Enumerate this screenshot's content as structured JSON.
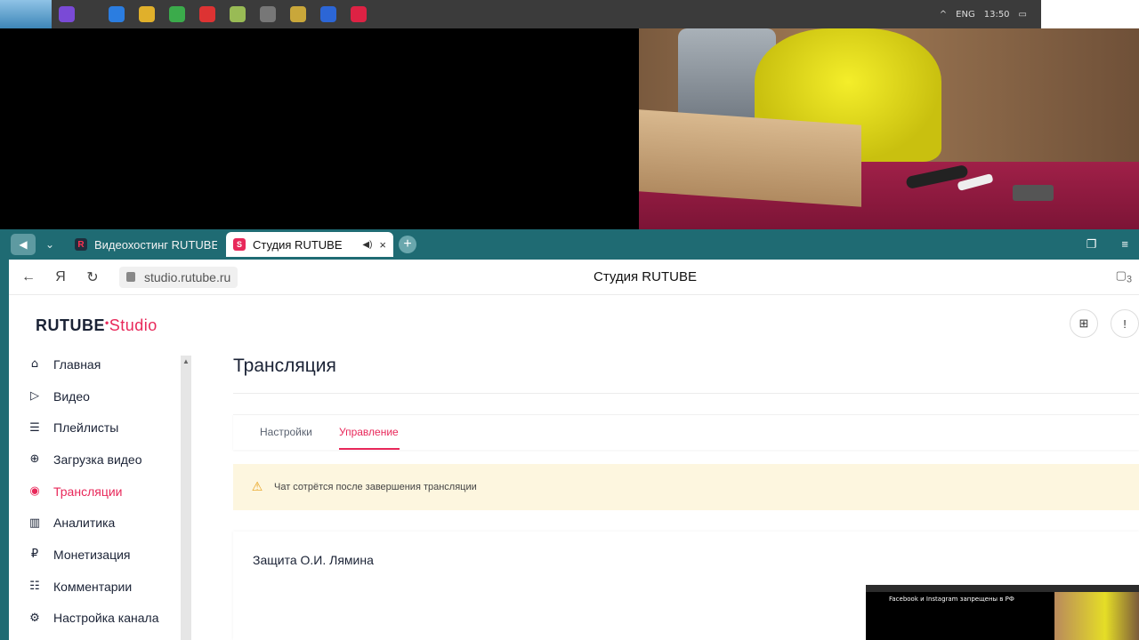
{
  "remote_taskbar": {
    "tray_lang": "ENG",
    "tray_time": "13:50"
  },
  "browser": {
    "tabs": [
      {
        "title": "Видеохостинг RUTUBE. С",
        "active": false
      },
      {
        "title": "Студия RUTUBE",
        "active": true
      }
    ],
    "url": "studio.rutube.ru",
    "page_title": "Студия RUTUBE",
    "counter": "3"
  },
  "logo": {
    "brand": "RUTUBE",
    "product": "Studio"
  },
  "sidebar": {
    "items": [
      {
        "label": "Главная",
        "icon": "home-icon",
        "glyph": "⌂"
      },
      {
        "label": "Видео",
        "icon": "video-icon",
        "glyph": "▷"
      },
      {
        "label": "Плейлисты",
        "icon": "playlist-icon",
        "glyph": "☰"
      },
      {
        "label": "Загрузка видео",
        "icon": "upload-icon",
        "glyph": "⊕"
      },
      {
        "label": "Трансляции",
        "icon": "broadcast-icon",
        "glyph": "◉"
      },
      {
        "label": "Аналитика",
        "icon": "analytics-icon",
        "glyph": "▥"
      },
      {
        "label": "Монетизация",
        "icon": "ruble-icon",
        "glyph": "₽"
      },
      {
        "label": "Комментарии",
        "icon": "comment-icon",
        "glyph": "☷"
      },
      {
        "label": "Настройка канала",
        "icon": "gear-icon",
        "glyph": "⚙"
      }
    ],
    "active_index": 4
  },
  "main": {
    "title": "Трансляция",
    "tabs": [
      {
        "label": "Настройки"
      },
      {
        "label": "Управление"
      }
    ],
    "active_tab": 1,
    "notice": "Чат сотрётся после завершения трансляции",
    "stream_name": "Защита О.И. Лямина"
  },
  "pip": {
    "text": "Facebook и Instagram запрещены в РФ"
  },
  "colors": {
    "accent": "#e8285a",
    "browser_chrome": "#1f6b73",
    "notice_bg": "#fdf6df"
  }
}
